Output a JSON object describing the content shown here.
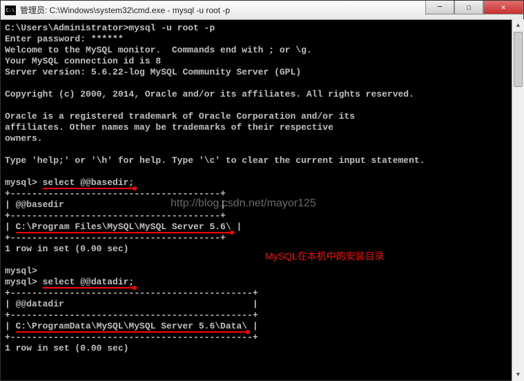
{
  "window": {
    "title": "管理员: C:\\Windows\\system32\\cmd.exe - mysql  -u root -p"
  },
  "terminal": {
    "line1": "C:\\Users\\Administrator>mysql -u root -p",
    "line2": "Enter password: ******",
    "line3": "Welcome to the MySQL monitor.  Commands end with ; or \\g.",
    "line4": "Your MySQL connection id is 8",
    "line5": "Server version: 5.6.22-log MySQL Community Server (GPL)",
    "line6": "Copyright (c) 2000, 2014, Oracle and/or its affiliates. All rights reserved.",
    "line7": "Oracle is a registered trademark of Oracle Corporation and/or its",
    "line8": "affiliates. Other names may be trademarks of their respective",
    "line9": "owners.",
    "line10": "Type 'help;' or '\\h' for help. Type '\\c' to clear the current input statement.",
    "prompt1_pre": "mysql> ",
    "prompt1_cmd": "select @@basedir;",
    "sep1": "+---------------------------------------+",
    "col1": "| @@basedir                             |",
    "sep1b": "+---------------------------------------+",
    "val1_pre": "| ",
    "val1": "C:\\Program Files\\MySQL\\MySQL Server 5.6\\",
    "val1_post": " |",
    "sep1c": "+---------------------------------------+",
    "rows1": "1 row in set (0.00 sec)",
    "prompt2": "mysql>",
    "prompt3_pre": "mysql> ",
    "prompt3_cmd": "select @@datadir;",
    "sep2": "+---------------------------------------------+",
    "col2": "| @@datadir                                   |",
    "sep2b": "+---------------------------------------------+",
    "val2_pre": "| ",
    "val2": "C:\\ProgramData\\MySQL\\MySQL Server 5.6\\Data\\",
    "val2_post": " |",
    "sep2c": "+---------------------------------------------+",
    "rows2": "1 row in set (0.00 sec)"
  },
  "watermark": "http://blog.csdn.net/mayor125",
  "annotation": "MySQL在本机中的安装目录"
}
